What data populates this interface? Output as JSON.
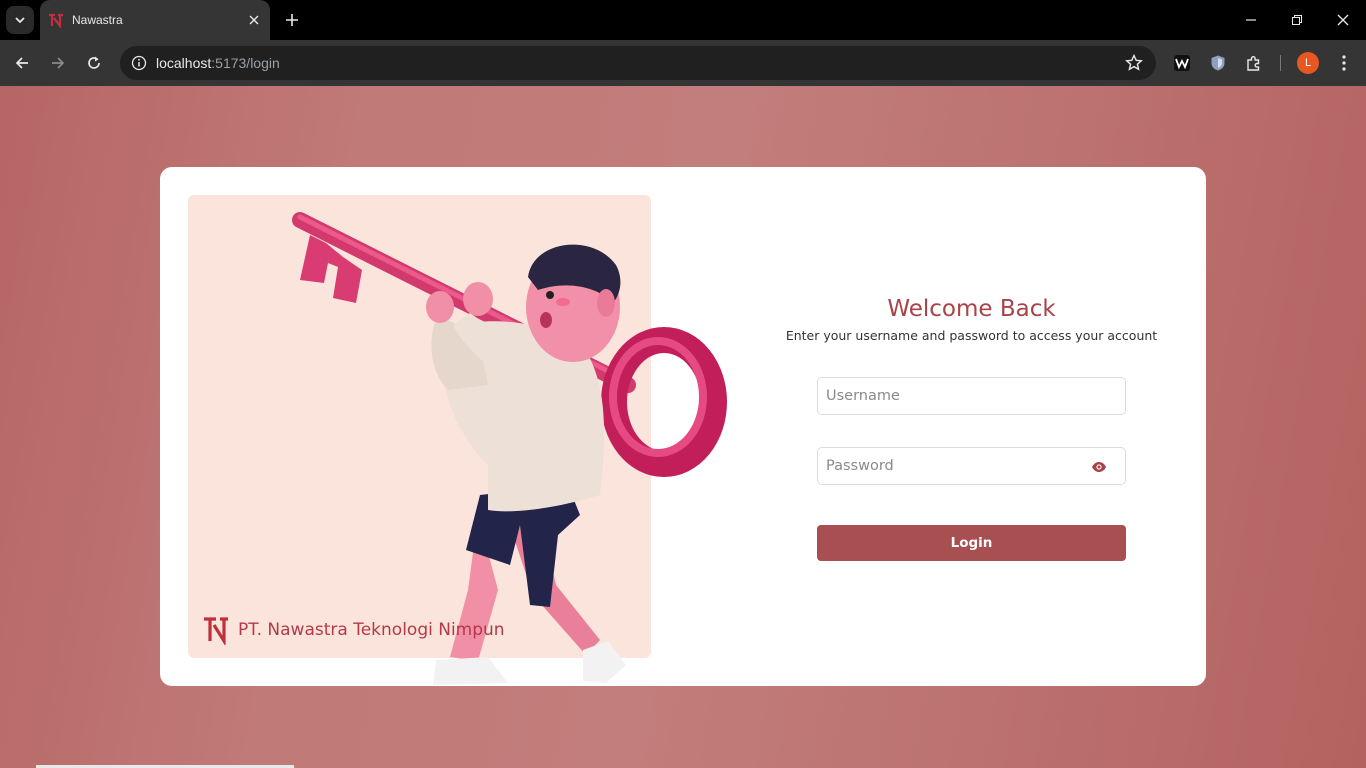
{
  "browser": {
    "tab_title": "Nawastra",
    "url_host": "localhost",
    "url_rest": ":5173/login",
    "profile_initial": "L"
  },
  "login": {
    "title": "Welcome Back",
    "subtitle": "Enter your username and password to access your account",
    "username_placeholder": "Username",
    "password_placeholder": "Password",
    "login_label": "Login"
  },
  "brand": {
    "company_name": "PT. Nawastra Teknologi Nimpun"
  },
  "colors": {
    "accent": "#a84f52",
    "title": "#a8434a",
    "panel_bg": "#fbe4dc",
    "page_bg": "#c07a78"
  }
}
